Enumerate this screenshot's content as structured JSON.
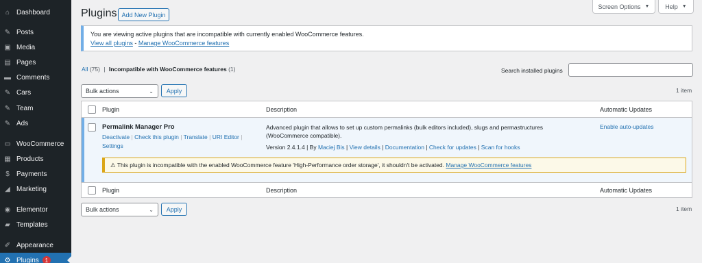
{
  "sidebar": {
    "items": [
      {
        "label": "Dashboard",
        "icon": "⌂",
        "icon_name": "dashboard-icon"
      },
      {
        "label": "Posts",
        "icon": "✎",
        "icon_name": "pin-icon"
      },
      {
        "label": "Media",
        "icon": "▣",
        "icon_name": "media-icon"
      },
      {
        "label": "Pages",
        "icon": "▤",
        "icon_name": "pages-icon"
      },
      {
        "label": "Comments",
        "icon": "▬",
        "icon_name": "comments-icon"
      },
      {
        "label": "Cars",
        "icon": "✎",
        "icon_name": "pin-icon"
      },
      {
        "label": "Team",
        "icon": "✎",
        "icon_name": "pin-icon"
      },
      {
        "label": "Ads",
        "icon": "✎",
        "icon_name": "pin-icon"
      },
      {
        "label": "WooCommerce",
        "icon": "▭",
        "icon_name": "woocommerce-icon"
      },
      {
        "label": "Products",
        "icon": "▦",
        "icon_name": "products-icon"
      },
      {
        "label": "Payments",
        "icon": "$",
        "icon_name": "payments-icon"
      },
      {
        "label": "Marketing",
        "icon": "◢",
        "icon_name": "marketing-icon"
      },
      {
        "label": "Elementor",
        "icon": "◉",
        "icon_name": "elementor-icon"
      },
      {
        "label": "Templates",
        "icon": "▰",
        "icon_name": "templates-icon"
      },
      {
        "label": "Appearance",
        "icon": "✐",
        "icon_name": "appearance-icon"
      },
      {
        "label": "Plugins",
        "icon": "⚙",
        "icon_name": "plugins-icon",
        "badge": "1"
      }
    ]
  },
  "top": {
    "screen_options": "Screen Options",
    "help": "Help"
  },
  "header": {
    "title": "Plugins",
    "add_new": "Add New Plugin"
  },
  "notice": {
    "text": "You are viewing active plugins that are incompatible with currently enabled WooCommerce features.",
    "link1": "View all plugins",
    "sep": " - ",
    "link2": "Manage WooCommerce features"
  },
  "filters": {
    "all_label": "All",
    "all_count": "(75)",
    "sep": "|",
    "current_label": "Incompatible with WooCommerce features",
    "current_count": "(1)",
    "search_label": "Search installed plugins"
  },
  "bulk": {
    "select_value": "Bulk actions",
    "apply": "Apply",
    "count": "1 item"
  },
  "table": {
    "col_plugin": "Plugin",
    "col_description": "Description",
    "col_auto": "Automatic Updates",
    "plugin": {
      "name": "Permalink Manager Pro",
      "actions": [
        "Deactivate",
        "Check this plugin",
        "Translate",
        "URI Editor",
        "Settings"
      ],
      "description": "Advanced plugin that allows to set up custom permalinks (bulk editors included), slugs and permastructures (WooCommerce compatible).",
      "version": "Version 2.4.1.4",
      "by": "By",
      "author": "Maciej Bis",
      "meta_links": [
        "View details",
        "Documentation",
        "Check for updates",
        "Scan for hooks"
      ],
      "auto_updates": "Enable auto-updates",
      "warning_text": "⚠ This plugin is incompatible with the enabled WooCommerce feature 'High-Performance order storage', it shouldn't be activated.",
      "warning_link": "Manage WooCommerce features"
    }
  }
}
